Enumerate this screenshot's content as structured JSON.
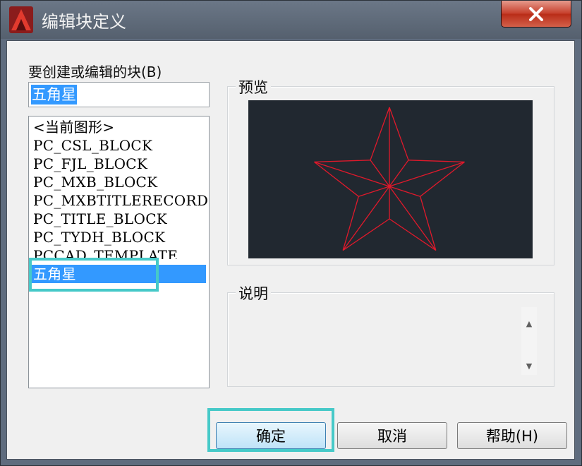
{
  "window": {
    "title": "编辑块定义",
    "close_glyph": "✕"
  },
  "block_section": {
    "label": "要创建或编辑的块(B)",
    "name_value": "五角星"
  },
  "block_list": [
    "<当前图形>",
    "PC_CSL_BLOCK",
    "PC_FJL_BLOCK",
    "PC_MXB_BLOCK",
    "PC_MXBTITLERECORD",
    "PC_TITLE_BLOCK",
    "PC_TYDH_BLOCK",
    "PCCAD_TEMPLATE",
    "五角星"
  ],
  "selected_index": 8,
  "preview": {
    "label": "预览",
    "background": "#212830",
    "stroke_color": "#e0192b"
  },
  "description": {
    "label": "说明",
    "text": ""
  },
  "buttons": {
    "ok": "确定",
    "cancel": "取消",
    "help": "帮助(H)"
  },
  "colors": {
    "selection": "#3399ff",
    "highlight_box": "#46c9c8"
  }
}
